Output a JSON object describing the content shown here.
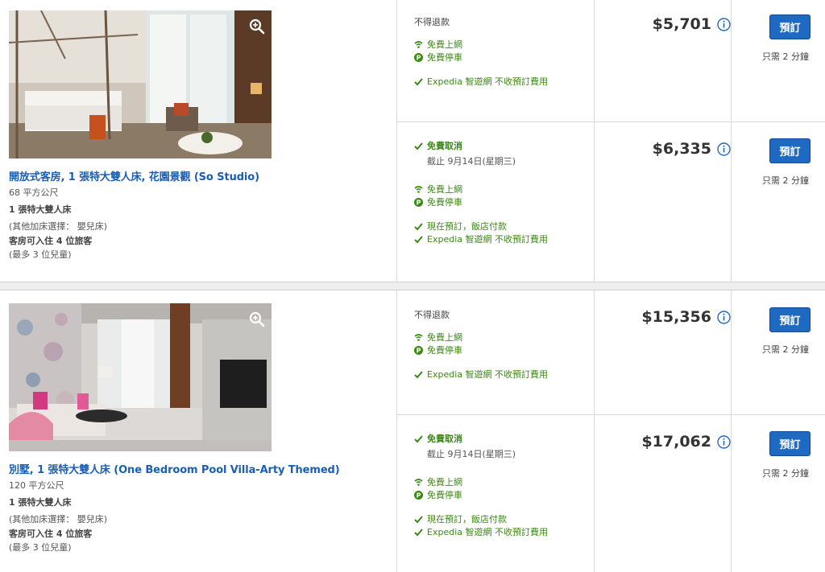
{
  "rooms": [
    {
      "name": "開放式客房, 1 張特大雙人床, 花園景觀 (So Studio)",
      "size": "68 平方公尺",
      "bed": "1 張特大雙人床",
      "extra_bed": "(其他加床選擇： 嬰兒床)",
      "occupancy": "客房可入住 4 位旅客",
      "children": "(最多 3 位兒童)",
      "rates": [
        {
          "policy": "不得退款",
          "wifi": "免費上網",
          "parking": "免費停車",
          "no_fee": "Expedia 智遊網 不收預訂費用",
          "price": "$5,701",
          "book": "預訂",
          "hint": "只需 2 分鐘"
        },
        {
          "policy": "免費取消",
          "deadline": "截止 9月14日(星期三)",
          "wifi": "免費上網",
          "parking": "免費停車",
          "pay_hotel": "現在預訂，飯店付款",
          "no_fee": "Expedia 智遊網 不收預訂費用",
          "price": "$6,335",
          "book": "預訂",
          "hint": "只需 2 分鐘"
        }
      ]
    },
    {
      "name": "別墅, 1 張特大雙人床 (One Bedroom Pool Villa-Arty Themed)",
      "size": "120 平方公尺",
      "bed": "1 張特大雙人床",
      "extra_bed": "(其他加床選擇： 嬰兒床)",
      "occupancy": "客房可入住 4 位旅客",
      "children": "(最多 3 位兒童)",
      "rates": [
        {
          "policy": "不得退款",
          "wifi": "免費上網",
          "parking": "免費停車",
          "no_fee": "Expedia 智遊網 不收預訂費用",
          "price": "$15,356",
          "book": "預訂",
          "hint": "只需 2 分鐘"
        },
        {
          "policy": "免費取消",
          "deadline": "截止 9月14日(星期三)",
          "wifi": "免費上網",
          "parking": "免費停車",
          "pay_hotel": "現在預訂，飯店付款",
          "no_fee": "Expedia 智遊網 不收預訂費用",
          "price": "$17,062",
          "book": "預訂",
          "hint": "只需 2 分鐘"
        }
      ]
    }
  ],
  "colors": {
    "link": "#1a5fb4",
    "green": "#3a8a12",
    "button": "#1e69c2"
  },
  "icons": {
    "zoom": "magnifier-icon",
    "wifi": "wifi-icon",
    "parking": "parking-icon",
    "check": "checkmark-icon",
    "info": "info-icon"
  }
}
